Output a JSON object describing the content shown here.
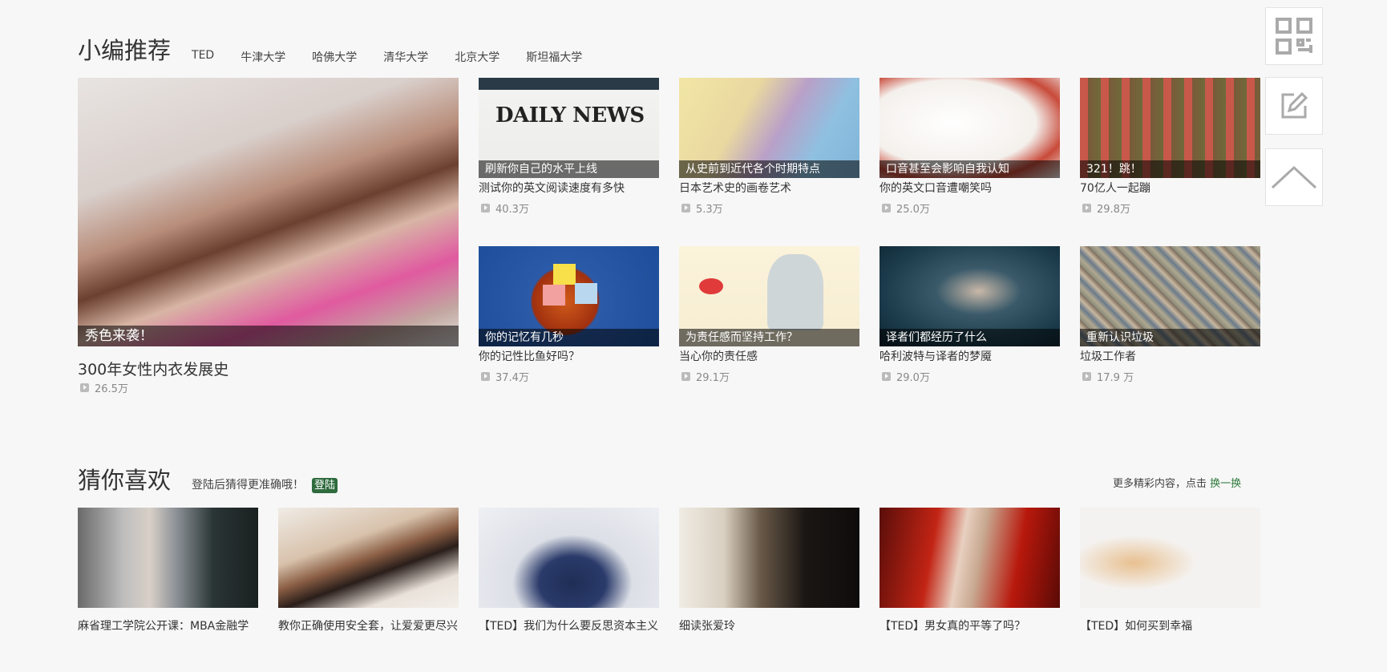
{
  "editor_picks": {
    "title": "小编推荐",
    "tabs": [
      "TED",
      "牛津大学",
      "哈佛大学",
      "清华大学",
      "北京大学",
      "斯坦福大学"
    ],
    "featured": {
      "caption": "秀色来袭！",
      "title": "300年女性内衣发展史",
      "views": "26.5万"
    },
    "cards": [
      {
        "caption": "刷新你自己的水平上线",
        "title": "测试你的英文阅读速度有多快",
        "views": "40.3万",
        "image_text": "DAILY NEWS"
      },
      {
        "caption": "从史前到近代各个时期特点",
        "title": "日本艺术史的画卷艺术",
        "views": "5.3万"
      },
      {
        "caption": "口音甚至会影响自我认知",
        "title": "你的英文口音遭嘲笑吗",
        "views": "25.0万"
      },
      {
        "caption": "321！跳！",
        "title": "70亿人一起蹦",
        "views": "29.8万"
      },
      {
        "caption": "你的记忆有几秒",
        "title": "你的记性比鱼好吗？",
        "views": "37.4万"
      },
      {
        "caption": "为责任感而坚持工作？",
        "title": "当心你的责任感",
        "views": "29.1万"
      },
      {
        "caption": "译者们都经历了什么",
        "title": "哈利波特与译者的梦魇",
        "views": "29.0万"
      },
      {
        "caption": "重新认识垃圾",
        "title": "垃圾工作者",
        "views": "17.9 万"
      }
    ]
  },
  "guess_you_like": {
    "title": "猜你喜欢",
    "hint": "登陆后猜得更准确哦！",
    "login_label": "登陆",
    "more_text": "更多精彩内容，点击",
    "swap_label": "换一换",
    "items": [
      {
        "title": "麻省理工学院公开课：MBA金融学"
      },
      {
        "title": "教你正确使用安全套，让爱爱更尽兴"
      },
      {
        "title": "【TED】我们为什么要反思资本主义"
      },
      {
        "title": "细读张爱玲"
      },
      {
        "title": "【TED】男女真的平等了吗？"
      },
      {
        "title": "【TED】如何买到幸福"
      }
    ]
  },
  "sidebar_icons": [
    "qr-code-icon",
    "edit-icon",
    "back-to-top-icon"
  ],
  "colors": {
    "accent_green": "#2f6b3e",
    "link_green": "#2f7a3d",
    "caption_bg": "rgba(0,0,0,0.55)"
  }
}
